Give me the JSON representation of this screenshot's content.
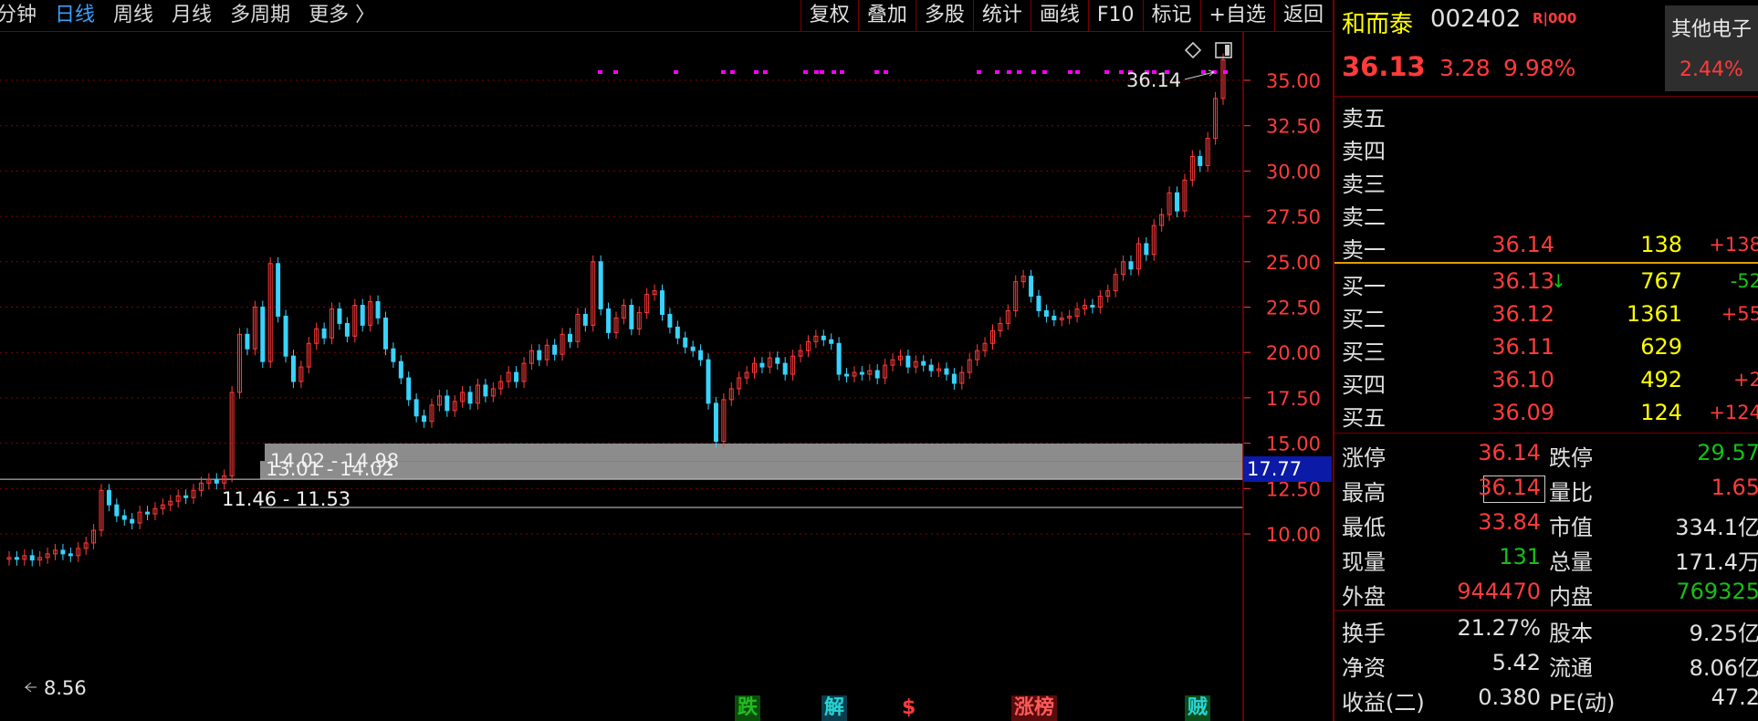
{
  "toolbar": {
    "period_tabs": [
      {
        "label": "分钟",
        "active": false
      },
      {
        "label": "日线",
        "active": true
      },
      {
        "label": "周线",
        "active": false
      },
      {
        "label": "月线",
        "active": false
      },
      {
        "label": "多周期",
        "active": false
      },
      {
        "label": "更多 〉",
        "active": false
      }
    ],
    "buttons": [
      "复权",
      "叠加",
      "多股",
      "统计",
      "画线",
      "F10",
      "标记",
      "+自选",
      "返回"
    ]
  },
  "chart": {
    "y_axis_labels": [
      "35.00",
      "32.50",
      "30.00",
      "27.50",
      "25.00",
      "22.50",
      "20.00",
      "17.50",
      "15.00",
      "12.50",
      "10.00"
    ],
    "current_price_flag": "17.77",
    "high_annotation": "36.14",
    "low_annotation": "8.56",
    "bands": [
      {
        "label": "14.02 - 14.98",
        "low": 14.02,
        "high": 14.98
      },
      {
        "label": "13.01 - 14.02",
        "low": 13.01,
        "high": 14.02
      },
      {
        "label": "11.46 - 11.53",
        "low": 11.46,
        "high": 11.53
      }
    ],
    "event_markers": [
      {
        "label": "跌",
        "color": "#1fbf1f",
        "bg": "#0b4d0b"
      },
      {
        "label": "解",
        "color": "#2ad3d3",
        "bg": "#0b3d4d"
      },
      {
        "label": "$",
        "color": "#ff3b3b",
        "bg": "#000000"
      },
      {
        "label": "涨榜",
        "color": "#ff5a5a",
        "bg": "#5a0b0b"
      },
      {
        "label": "贼",
        "color": "#2ad3d3",
        "bg": "#0b4d1a"
      }
    ],
    "icons": [
      "diamond-icon",
      "panel-toggle-icon"
    ]
  },
  "chart_data": {
    "type": "candlestick",
    "ylim": [
      8.5,
      37
    ],
    "y_ticks": [
      10,
      12.5,
      15,
      17.5,
      20,
      22.5,
      25,
      27.5,
      30,
      32.5,
      35
    ],
    "grid": true,
    "close": [
      8.7,
      8.6,
      8.8,
      8.56,
      8.7,
      8.9,
      9.1,
      8.9,
      8.8,
      9.2,
      9.5,
      10.2,
      12.4,
      11.6,
      11.0,
      10.8,
      10.6,
      11.2,
      11.1,
      11.4,
      11.6,
      11.8,
      12.1,
      12.0,
      12.4,
      12.8,
      13.0,
      12.8,
      13.2,
      17.8,
      21.0,
      20.2,
      22.5,
      19.5,
      24.9,
      22.0,
      19.8,
      18.4,
      19.2,
      20.5,
      21.3,
      20.8,
      22.4,
      21.6,
      20.9,
      22.6,
      21.5,
      22.8,
      21.9,
      20.2,
      19.5,
      18.6,
      17.4,
      16.5,
      16.2,
      17.1,
      17.6,
      16.8,
      17.3,
      17.8,
      17.2,
      18.2,
      17.6,
      18.0,
      18.4,
      18.9,
      18.4,
      19.4,
      20.1,
      19.6,
      20.4,
      19.9,
      21.0,
      20.6,
      22.1,
      21.5,
      25.0,
      22.4,
      21.1,
      21.9,
      22.6,
      21.3,
      22.2,
      23.2,
      23.4,
      22.1,
      21.4,
      20.8,
      20.3,
      20.1,
      19.6,
      17.2,
      15.1,
      17.4,
      18.0,
      18.6,
      18.9,
      19.4,
      19.2,
      19.7,
      19.4,
      18.8,
      19.8,
      20.1,
      20.6,
      20.9,
      20.7,
      20.5,
      18.8,
      18.7,
      18.9,
      18.8,
      19.0,
      18.6,
      19.3,
      19.6,
      19.8,
      19.2,
      19.5,
      19.3,
      19.0,
      19.1,
      18.8,
      18.3,
      18.9,
      19.6,
      20.1,
      20.5,
      21.2,
      21.6,
      22.3,
      23.9,
      24.2,
      23.1,
      22.3,
      22.0,
      21.8,
      21.9,
      22.0,
      22.4,
      22.6,
      22.5,
      23.1,
      23.4,
      24.3,
      25.0,
      24.6,
      26.0,
      25.4,
      27.0,
      27.6,
      28.8,
      27.8,
      29.5,
      30.8,
      30.3,
      31.8,
      34.0,
      36.13
    ]
  },
  "stock": {
    "name": "和而泰",
    "code": "002402",
    "tag": "R|000",
    "last_price": "36.13",
    "change": "3.28",
    "change_pct": "9.98%",
    "sector_name": "其他电子",
    "sector_pct": "2.44%"
  },
  "orderbook": {
    "asks": [
      {
        "label": "卖五",
        "price": "",
        "vol": "",
        "chg": ""
      },
      {
        "label": "卖四",
        "price": "",
        "vol": "",
        "chg": ""
      },
      {
        "label": "卖三",
        "price": "",
        "vol": "",
        "chg": ""
      },
      {
        "label": "卖二",
        "price": "",
        "vol": "",
        "chg": ""
      },
      {
        "label": "卖一",
        "price": "36.14",
        "vol": "138",
        "chg": "+138"
      }
    ],
    "bids": [
      {
        "label": "买一",
        "price": "36.13",
        "vol": "767",
        "chg": "-52"
      },
      {
        "label": "买二",
        "price": "36.12",
        "vol": "1361",
        "chg": "+55"
      },
      {
        "label": "买三",
        "price": "36.11",
        "vol": "629",
        "chg": ""
      },
      {
        "label": "买四",
        "price": "36.10",
        "vol": "492",
        "chg": "+2"
      },
      {
        "label": "买五",
        "price": "36.09",
        "vol": "124",
        "chg": "+124"
      }
    ],
    "arrow": "↓"
  },
  "stats": [
    {
      "l1": "涨停",
      "v1": "36.14",
      "c1": "#ff3b3b",
      "l2": "跌停",
      "v2": "29.57",
      "c2": "#16c016"
    },
    {
      "l1": "最高",
      "v1": "36.14",
      "c1": "#ff3b3b",
      "l2": "量比",
      "v2": "1.65",
      "c2": "#ff3b3b"
    },
    {
      "l1": "最低",
      "v1": "33.84",
      "c1": "#ff3b3b",
      "l2": "市值",
      "v2": "334.1亿",
      "c2": "#e0e0e0"
    },
    {
      "l1": "现量",
      "v1": "131",
      "c1": "#16c016",
      "l2": "总量",
      "v2": "171.4万",
      "c2": "#e0e0e0"
    },
    {
      "l1": "外盘",
      "v1": "944470",
      "c1": "#ff3b3b",
      "l2": "内盘",
      "v2": "769325",
      "c2": "#16c016"
    }
  ],
  "stats2": [
    {
      "l1": "换手",
      "v1": "21.27%",
      "c1": "#e0e0e0",
      "l2": "股本",
      "v2": "9.25亿",
      "c2": "#e0e0e0"
    },
    {
      "l1": "净资",
      "v1": "5.42",
      "c1": "#e0e0e0",
      "l2": "流通",
      "v2": "8.06亿",
      "c2": "#e0e0e0"
    },
    {
      "l1": "收益(二)",
      "v1": "0.380",
      "c1": "#e0e0e0",
      "l2": "PE(动)",
      "v2": "47.2",
      "c2": "#e0e0e0"
    }
  ],
  "colors": {
    "up": "#ff3b3b",
    "down": "#39d3ff",
    "grid": "#8a0000",
    "band": "#8c8c8c"
  }
}
